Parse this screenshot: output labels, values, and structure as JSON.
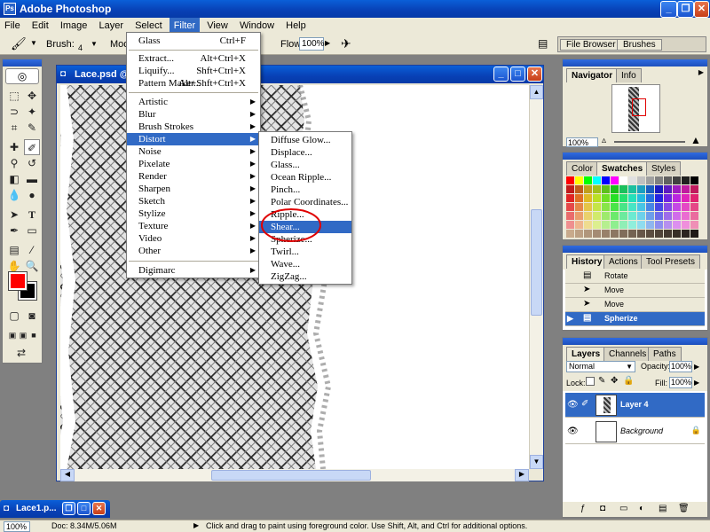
{
  "app": {
    "title": "Adobe Photoshop"
  },
  "menubar": [
    "File",
    "Edit",
    "Image",
    "Layer",
    "Select",
    "Filter",
    "View",
    "Window",
    "Help"
  ],
  "options": {
    "brush_label": "Brush:",
    "brush_size": "4",
    "mode_label": "Mod",
    "flow_label": "Flow:",
    "flow_value": "100%"
  },
  "palette_well": {
    "tab1": "File Browser",
    "tab2": "Brushes"
  },
  "document": {
    "title": "Lace.psd @ 1"
  },
  "filter_menu": {
    "items": [
      {
        "label": "Glass",
        "shortcut": "Ctrl+F"
      },
      {
        "label": "Extract...",
        "shortcut": "Alt+Ctrl+X"
      },
      {
        "label": "Liquify...",
        "shortcut": "Shft+Ctrl+X"
      },
      {
        "label": "Pattern Maker...",
        "shortcut": "Alt+Shft+Ctrl+X"
      },
      {
        "label": "Artistic"
      },
      {
        "label": "Blur"
      },
      {
        "label": "Brush Strokes"
      },
      {
        "label": "Distort"
      },
      {
        "label": "Noise"
      },
      {
        "label": "Pixelate"
      },
      {
        "label": "Render"
      },
      {
        "label": "Sharpen"
      },
      {
        "label": "Sketch"
      },
      {
        "label": "Stylize"
      },
      {
        "label": "Texture"
      },
      {
        "label": "Video"
      },
      {
        "label": "Other"
      },
      {
        "label": "Digimarc"
      }
    ]
  },
  "distort_menu": {
    "items": [
      "Diffuse Glow...",
      "Displace...",
      "Glass...",
      "Ocean Ripple...",
      "Pinch...",
      "Polar Coordinates...",
      "Ripple...",
      "Shear...",
      "Spherize...",
      "Twirl...",
      "Wave...",
      "ZigZag..."
    ]
  },
  "navigator": {
    "tab_active": "Navigator",
    "tab_info": "Info",
    "zoom": "100%"
  },
  "swatches": {
    "tab_color": "Color",
    "tab_active": "Swatches",
    "tab_styles": "Styles"
  },
  "history": {
    "tab_active": "History",
    "tab_actions": "Actions",
    "tab_presets": "Tool Presets",
    "items": [
      "Rotate",
      "Move",
      "Move",
      "Spherize"
    ]
  },
  "layers": {
    "tab_active": "Layers",
    "tab_channels": "Channels",
    "tab_paths": "Paths",
    "blend_mode": "Normal",
    "opacity_label": "Opacity:",
    "opacity": "100%",
    "lock_label": "Lock:",
    "fill_label": "Fill:",
    "fill": "100%",
    "items": [
      "Layer 4",
      "Background"
    ]
  },
  "minimized": {
    "title": "Lace1.p..."
  },
  "status": {
    "zoom": "100%",
    "doc": "Doc: 8.34M/5.06M",
    "hint": "Click and drag to paint using foreground color.  Use Shift, Alt, and Ctrl for additional options."
  },
  "colors": {
    "foreground": "#ff0000",
    "background": "#000000",
    "accent": "#316ac5"
  }
}
